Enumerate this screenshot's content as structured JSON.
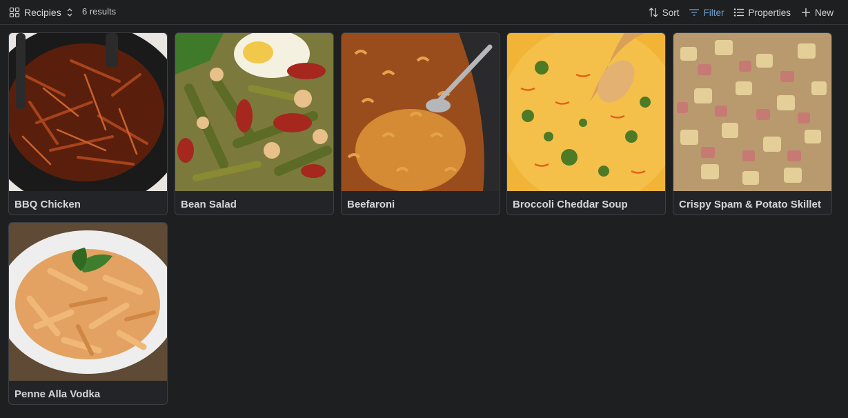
{
  "toolbar": {
    "view_name": "Recipies",
    "result_count": "6 results",
    "sort_label": "Sort",
    "filter_label": "Filter",
    "properties_label": "Properties",
    "new_label": "New"
  },
  "colors": {
    "accent": "#6f9fce",
    "background": "#1e1f21",
    "card_border": "#3d3f43"
  },
  "gallery": {
    "cards": [
      {
        "title": "BBQ Chicken",
        "image": "pulled-bbq-chicken-photo"
      },
      {
        "title": "Bean Salad",
        "image": "bean-salad-photo"
      },
      {
        "title": "Beefaroni",
        "image": "beefaroni-photo"
      },
      {
        "title": "Broccoli Cheddar Soup",
        "image": "broccoli-cheddar-soup-photo"
      },
      {
        "title": "Crispy Spam & Potato Skillet",
        "image": "spam-potato-skillet-photo"
      },
      {
        "title": "Penne Alla Vodka",
        "image": "penne-alla-vodka-photo"
      }
    ]
  }
}
